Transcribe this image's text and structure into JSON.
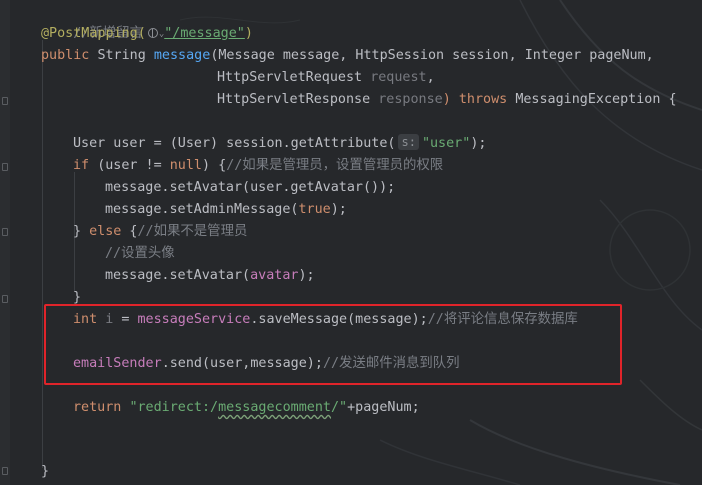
{
  "lines": {
    "l1": "//新增留言",
    "l2_annot": "@PostMapping(",
    "l2_str": "\"/message\"",
    "l2_close": ")",
    "l3_public": "public ",
    "l3_type": "String ",
    "l3_method": "message",
    "l3_params": "(Message message, HttpSession session, Integer pageNum,",
    "l4_type": "HttpServletRequest ",
    "l4_param": "request",
    "l4_comma": ",",
    "l5_type": "HttpServletResponse ",
    "l5_param": "response",
    "l5_throws": ") throws ",
    "l5_exc": "MessagingException {",
    "l7_a": "User user = (User) session.getAttribute(",
    "l7_hint": "s:",
    "l7_str": "\"user\"",
    "l7_end": ");",
    "l8_if": "if ",
    "l8_a": "(user != ",
    "l8_null": "null",
    "l8_b": ") {",
    "l8_comment": "//如果是管理员，设置管理员的权限",
    "l9": "message.setAvatar(user.getAvatar());",
    "l10_a": "message.setAdminMessage(",
    "l10_true": "true",
    "l10_b": ");",
    "l11_a": "} ",
    "l11_else": "else",
    "l11_b": " {",
    "l11_comment": "//如果不是管理员",
    "l12_comment": "//设置头像",
    "l13_a": "message.setAvatar(",
    "l13_field": "avatar",
    "l13_b": ");",
    "l14": "}",
    "l15_int": "int ",
    "l15_i": "i",
    "l15_eq": " = ",
    "l15_svc": "messageService",
    "l15_call": ".saveMessage(message);",
    "l15_comment": "//将评论信息保存数据库",
    "l17_sender": "emailSender",
    "l17_call": ".send(user,message);",
    "l17_comment": "//发送邮件消息到队列",
    "l19_return": "return ",
    "l19_str1": "\"redirect:/",
    "l19_str2": "messagecomment",
    "l19_str3": "/\"",
    "l19_end": "+pageNum;",
    "l22": "}"
  },
  "colors": {
    "background": "#26282b",
    "keyword": "#cf8e6d",
    "string": "#6aab73",
    "comment": "#7a7e85",
    "method": "#56a8f5",
    "field": "#c77dbb",
    "annotation": "#b3ae60",
    "highlight_border": "#e0242a"
  }
}
